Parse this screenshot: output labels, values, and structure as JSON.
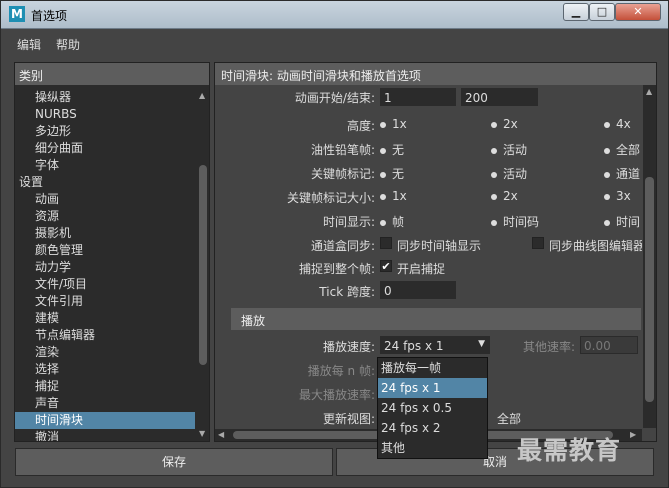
{
  "window": {
    "title": "首选项",
    "logo": "M"
  },
  "menu": {
    "edit": "编辑",
    "help": "帮助"
  },
  "categories": {
    "header": "类别",
    "items": [
      "操纵器",
      "NURBS",
      "多边形",
      "细分曲面",
      "字体",
      "设置",
      "动画",
      "资源",
      "摄影机",
      "颜色管理",
      "动力学",
      "文件/项目",
      "文件引用",
      "建模",
      "节点编辑器",
      "渲染",
      "选择",
      "捕捉",
      "声音",
      "时间滑块",
      "撤消"
    ],
    "selected": "时间滑块"
  },
  "panel": {
    "header": "时间滑块: 动画时间滑块和播放首选项",
    "anim_range": {
      "label": "动画开始/结束:",
      "start": "1",
      "end": "200"
    },
    "height": {
      "label": "高度:",
      "options": [
        "1x",
        "2x",
        "4x"
      ]
    },
    "onion": {
      "label": "油性铅笔帧:",
      "options": [
        "无",
        "活动",
        "全部"
      ]
    },
    "keyticks": {
      "label": "关键帧标记:",
      "options": [
        "无",
        "活动",
        "通道"
      ]
    },
    "keysize": {
      "label": "关键帧标记大小:",
      "options": [
        "1x",
        "2x",
        "3x"
      ]
    },
    "timedisp": {
      "label": "时间显示:",
      "options": [
        "帧",
        "时间码",
        "时间"
      ]
    },
    "chanbox": {
      "label": "通道盒同步:",
      "opt1": "同步时间轴显示",
      "opt2": "同步曲线图编辑器"
    },
    "snap": {
      "label": "捕捉到整个帧:",
      "opt": "开启捕捉"
    },
    "tick": {
      "label": "Tick 跨度:",
      "value": "0"
    },
    "playback_header": "播放",
    "speed": {
      "label": "播放速度:",
      "value": "24 fps x 1",
      "other_label": "其他速率:",
      "other_value": "0.00"
    },
    "every_n": {
      "label": "播放每 n 帧:"
    },
    "max_speed": {
      "label": "最大播放速率:"
    },
    "update_view": {
      "label": "更新视图:",
      "value": "全部"
    }
  },
  "dropdown_options": [
    "播放每一帧",
    "24 fps x 1",
    "24 fps x 0.5",
    "24 fps x 2",
    "其他"
  ],
  "buttons": {
    "save": "保存",
    "cancel": "取消"
  },
  "watermark": "最需教育"
}
